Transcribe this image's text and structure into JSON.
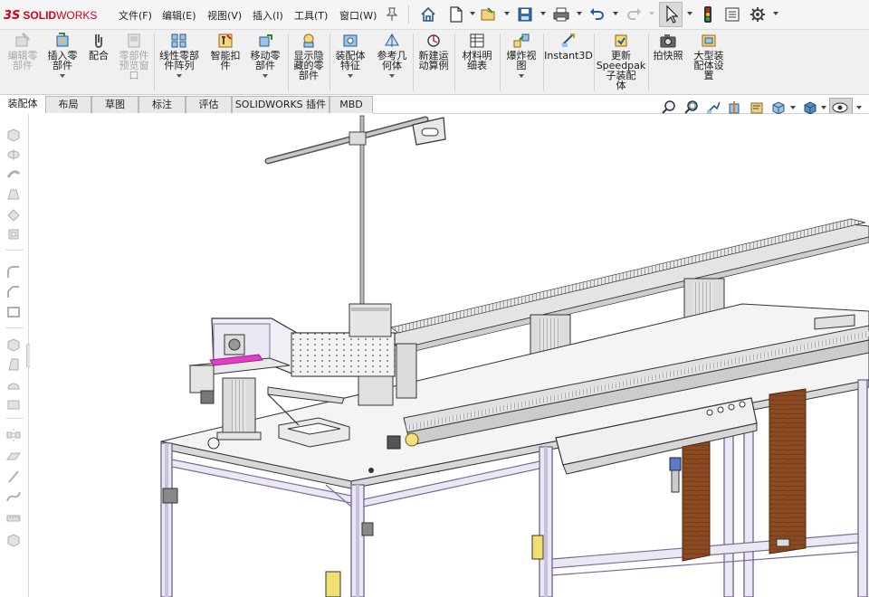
{
  "app": {
    "logo_ds": "3S",
    "logo_solid": "SOLID",
    "logo_works": "WORKS"
  },
  "menu": {
    "items": [
      "文件(F)",
      "编辑(E)",
      "视图(V)",
      "插入(I)",
      "工具(T)",
      "窗口(W)"
    ]
  },
  "toolbar": {
    "icons": [
      "home-icon",
      "new-document-icon",
      "open-icon",
      "save-icon",
      "print-icon",
      "undo-icon",
      "redo-icon",
      "select-arrow-icon",
      "rebuild-icon",
      "file-properties-icon",
      "options-gear-icon"
    ]
  },
  "ribbon": {
    "commands": [
      {
        "label": "编辑零\n部件",
        "enabled": false,
        "icon": "edit-component-icon"
      },
      {
        "label": "插入零\n部件",
        "enabled": true,
        "icon": "insert-component-icon"
      },
      {
        "label": "配合",
        "enabled": true,
        "icon": "mate-icon"
      },
      {
        "label": "零部件\n预览窗\n口",
        "enabled": false,
        "icon": "component-preview-icon"
      },
      {
        "label": "线性零部\n件阵列",
        "enabled": true,
        "icon": "linear-pattern-icon"
      },
      {
        "label": "智能扣\n件",
        "enabled": true,
        "icon": "smart-fastener-icon"
      },
      {
        "label": "移动零\n部件",
        "enabled": true,
        "icon": "move-component-icon"
      },
      {
        "label": "显示隐\n藏的零\n部件",
        "enabled": true,
        "icon": "show-hidden-icon"
      },
      {
        "label": "装配体\n特征",
        "enabled": true,
        "icon": "assembly-feature-icon"
      },
      {
        "label": "参考几\n何体",
        "enabled": true,
        "icon": "reference-geometry-icon"
      },
      {
        "label": "新建运\n动算例",
        "enabled": true,
        "icon": "motion-study-icon"
      },
      {
        "label": "材料明\n细表",
        "enabled": true,
        "icon": "bom-icon"
      },
      {
        "label": "爆炸视\n图",
        "enabled": true,
        "icon": "exploded-view-icon"
      },
      {
        "label": "Instant3D",
        "enabled": true,
        "icon": "instant3d-icon"
      },
      {
        "label": "更新\nSpeedpak\n子装配\n体",
        "enabled": true,
        "icon": "speedpak-icon"
      },
      {
        "label": "拍快照",
        "enabled": true,
        "icon": "snapshot-icon"
      },
      {
        "label": "大型装\n配体设\n置",
        "enabled": true,
        "icon": "large-assembly-icon"
      }
    ]
  },
  "tabs": [
    "装配体",
    "布局",
    "草图",
    "标注",
    "评估",
    "SOLIDWORKS 插件",
    "MBD"
  ],
  "active_tab": "装配体",
  "hud_icons": [
    "zoom-to-fit-icon",
    "zoom-area-icon",
    "previous-view-icon",
    "section-view-icon",
    "dynamic-annotation-icon",
    "view-orientation-icon",
    "display-style-icon",
    "hide-show-items-icon"
  ],
  "colors": {
    "accent_red": "#d0021b",
    "frame_purple": "#7a6a9a",
    "wood_brown": "#8b4a22",
    "highlight_magenta": "#e040c0"
  }
}
